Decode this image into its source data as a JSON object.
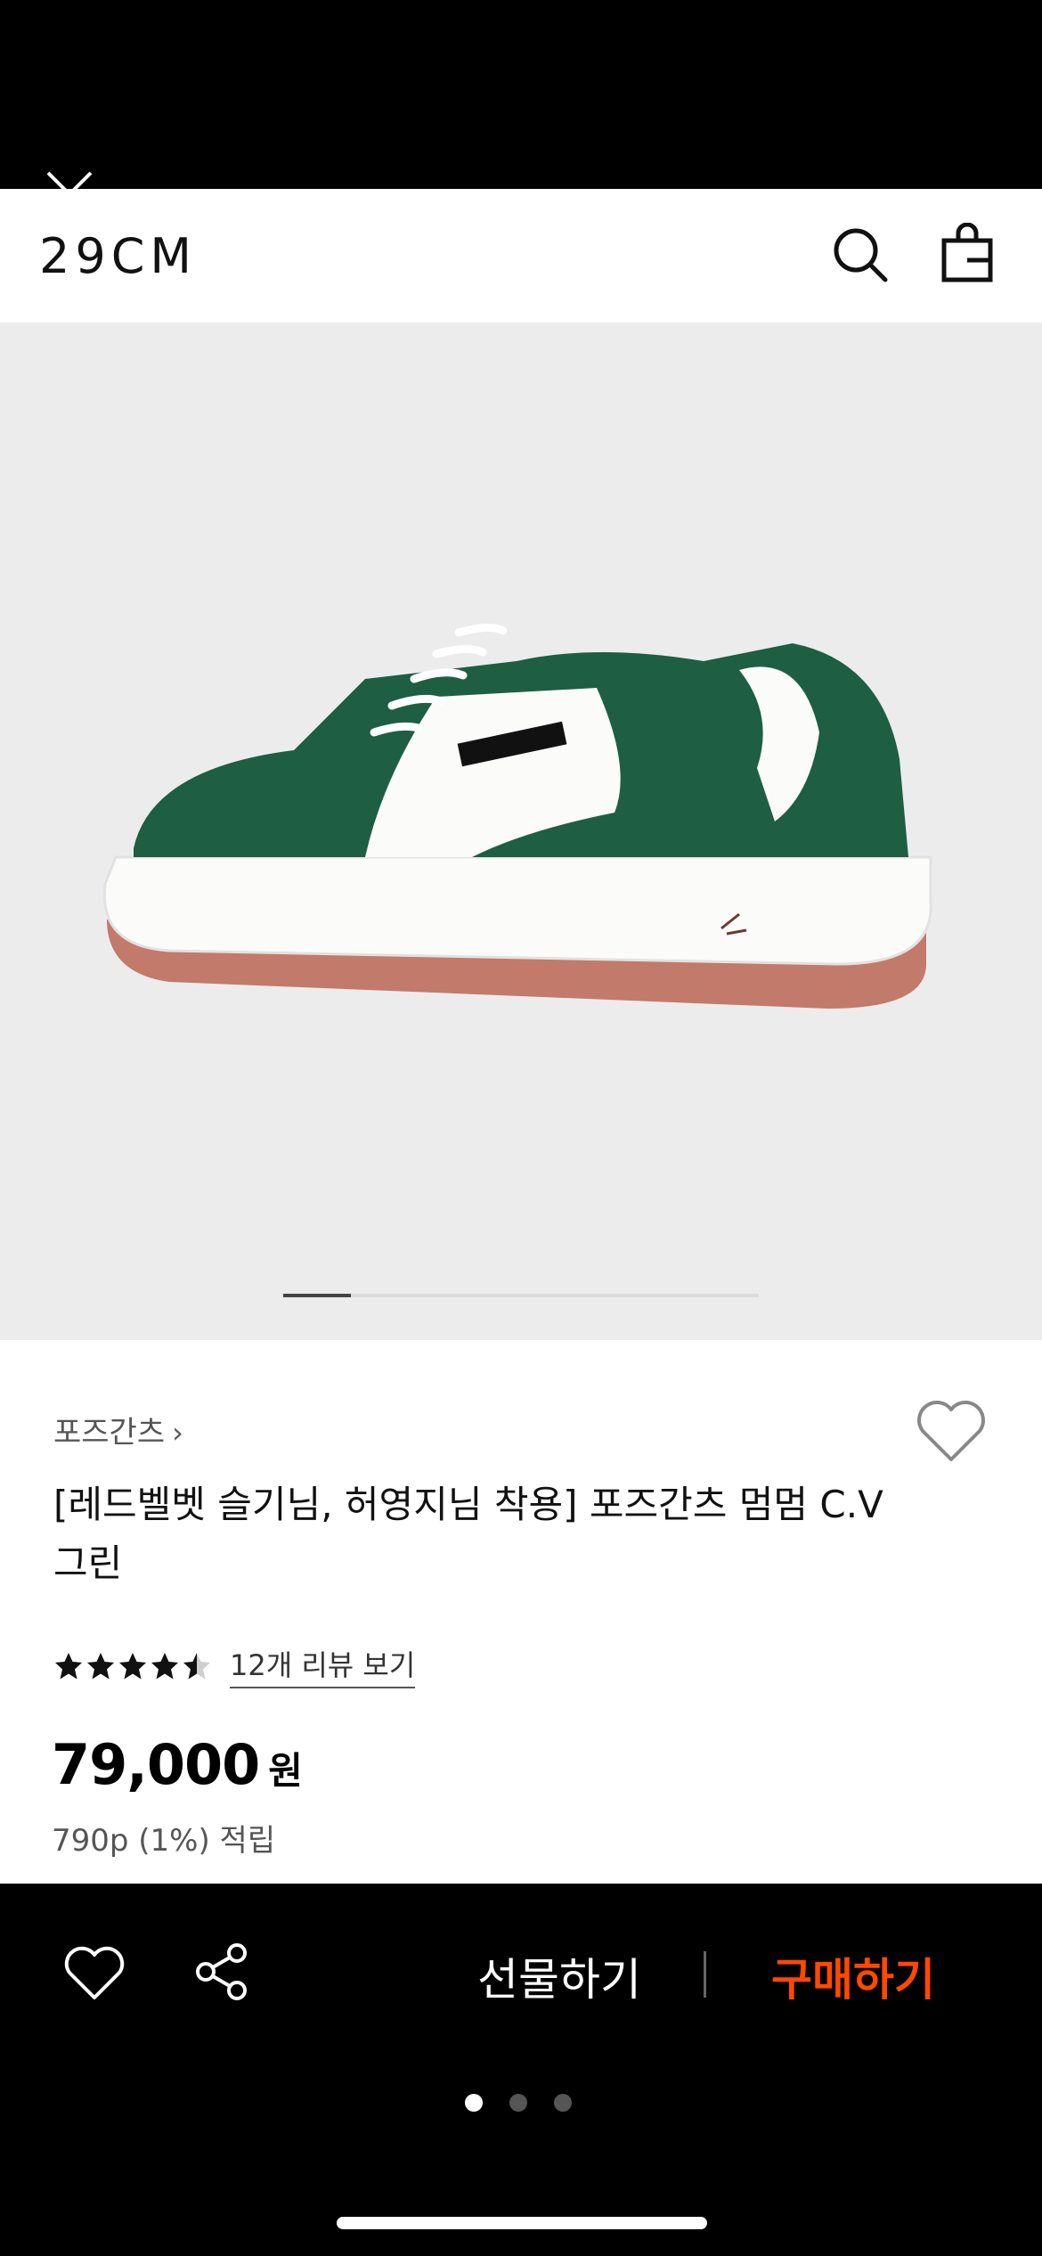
{
  "app": {
    "logo": "29CM"
  },
  "header": {
    "icons": [
      "close-icon",
      "search-icon",
      "shopping-bag-icon"
    ]
  },
  "gallery": {
    "current_index": 1,
    "total": 7,
    "position_fraction": 0.14
  },
  "product": {
    "brand": "포즈간츠",
    "brand_chevron": "›",
    "title": "[레드벨벳 슬기님, 허영지님 착용] 포즈간츠 멈멈 C.V 그린",
    "rating": 4.5,
    "reviews_link": "12개 리뷰 보기",
    "price": "79,000",
    "price_unit": "원",
    "points": "790p (1%) 적립"
  },
  "bottom_bar": {
    "gift_label": "선물하기",
    "buy_label": "구매하기",
    "buy_color": "#ff4800"
  },
  "page_dots": {
    "count": 3,
    "active": 0
  }
}
